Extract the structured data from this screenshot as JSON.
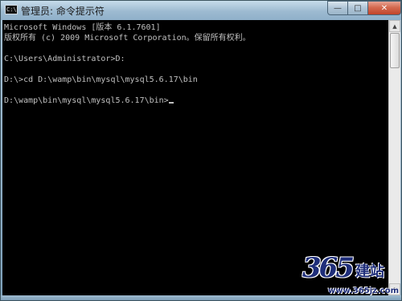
{
  "window": {
    "title": "管理员: 命令提示符",
    "icon_label": "C:\\",
    "buttons": {
      "minimize": "—",
      "maximize": "□",
      "close": "✕"
    }
  },
  "console": {
    "lines": [
      "Microsoft Windows [版本 6.1.7601]",
      "版权所有 (c) 2009 Microsoft Corporation。保留所有权利。",
      "",
      "C:\\Users\\Administrator>D:",
      "",
      "D:\\>cd D:\\wamp\\bin\\mysql\\mysql5.6.17\\bin",
      "",
      "D:\\wamp\\bin\\mysql\\mysql5.6.17\\bin>"
    ]
  },
  "watermark": {
    "number": "365",
    "text": "建站",
    "url": "www.365jz.com"
  },
  "colors": {
    "console_bg": "#000000",
    "console_text": "#c0c0c0",
    "close_button": "#c1442a"
  }
}
